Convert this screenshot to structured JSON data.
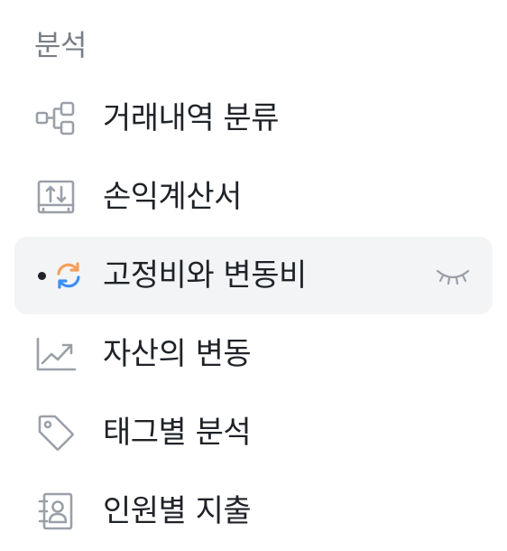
{
  "section": {
    "title": "분석"
  },
  "menu": {
    "items": [
      {
        "label": "거래내역 분류",
        "icon": "flow-icon",
        "active": false
      },
      {
        "label": "손익계산서",
        "icon": "income-statement-icon",
        "active": false
      },
      {
        "label": "고정비와 변동비",
        "icon": "refresh-icon",
        "active": true
      },
      {
        "label": "자산의 변동",
        "icon": "trend-chart-icon",
        "active": false
      },
      {
        "label": "태그별 분석",
        "icon": "tag-icon",
        "active": false
      },
      {
        "label": "인원별 지출",
        "icon": "contact-book-icon",
        "active": false
      }
    ]
  },
  "colors": {
    "icon_gray": "#9aa0a8",
    "accent_orange": "#f5a05a",
    "accent_blue": "#3d8ff5",
    "active_bg": "#f3f4f6",
    "section_title": "#7a7f87"
  }
}
